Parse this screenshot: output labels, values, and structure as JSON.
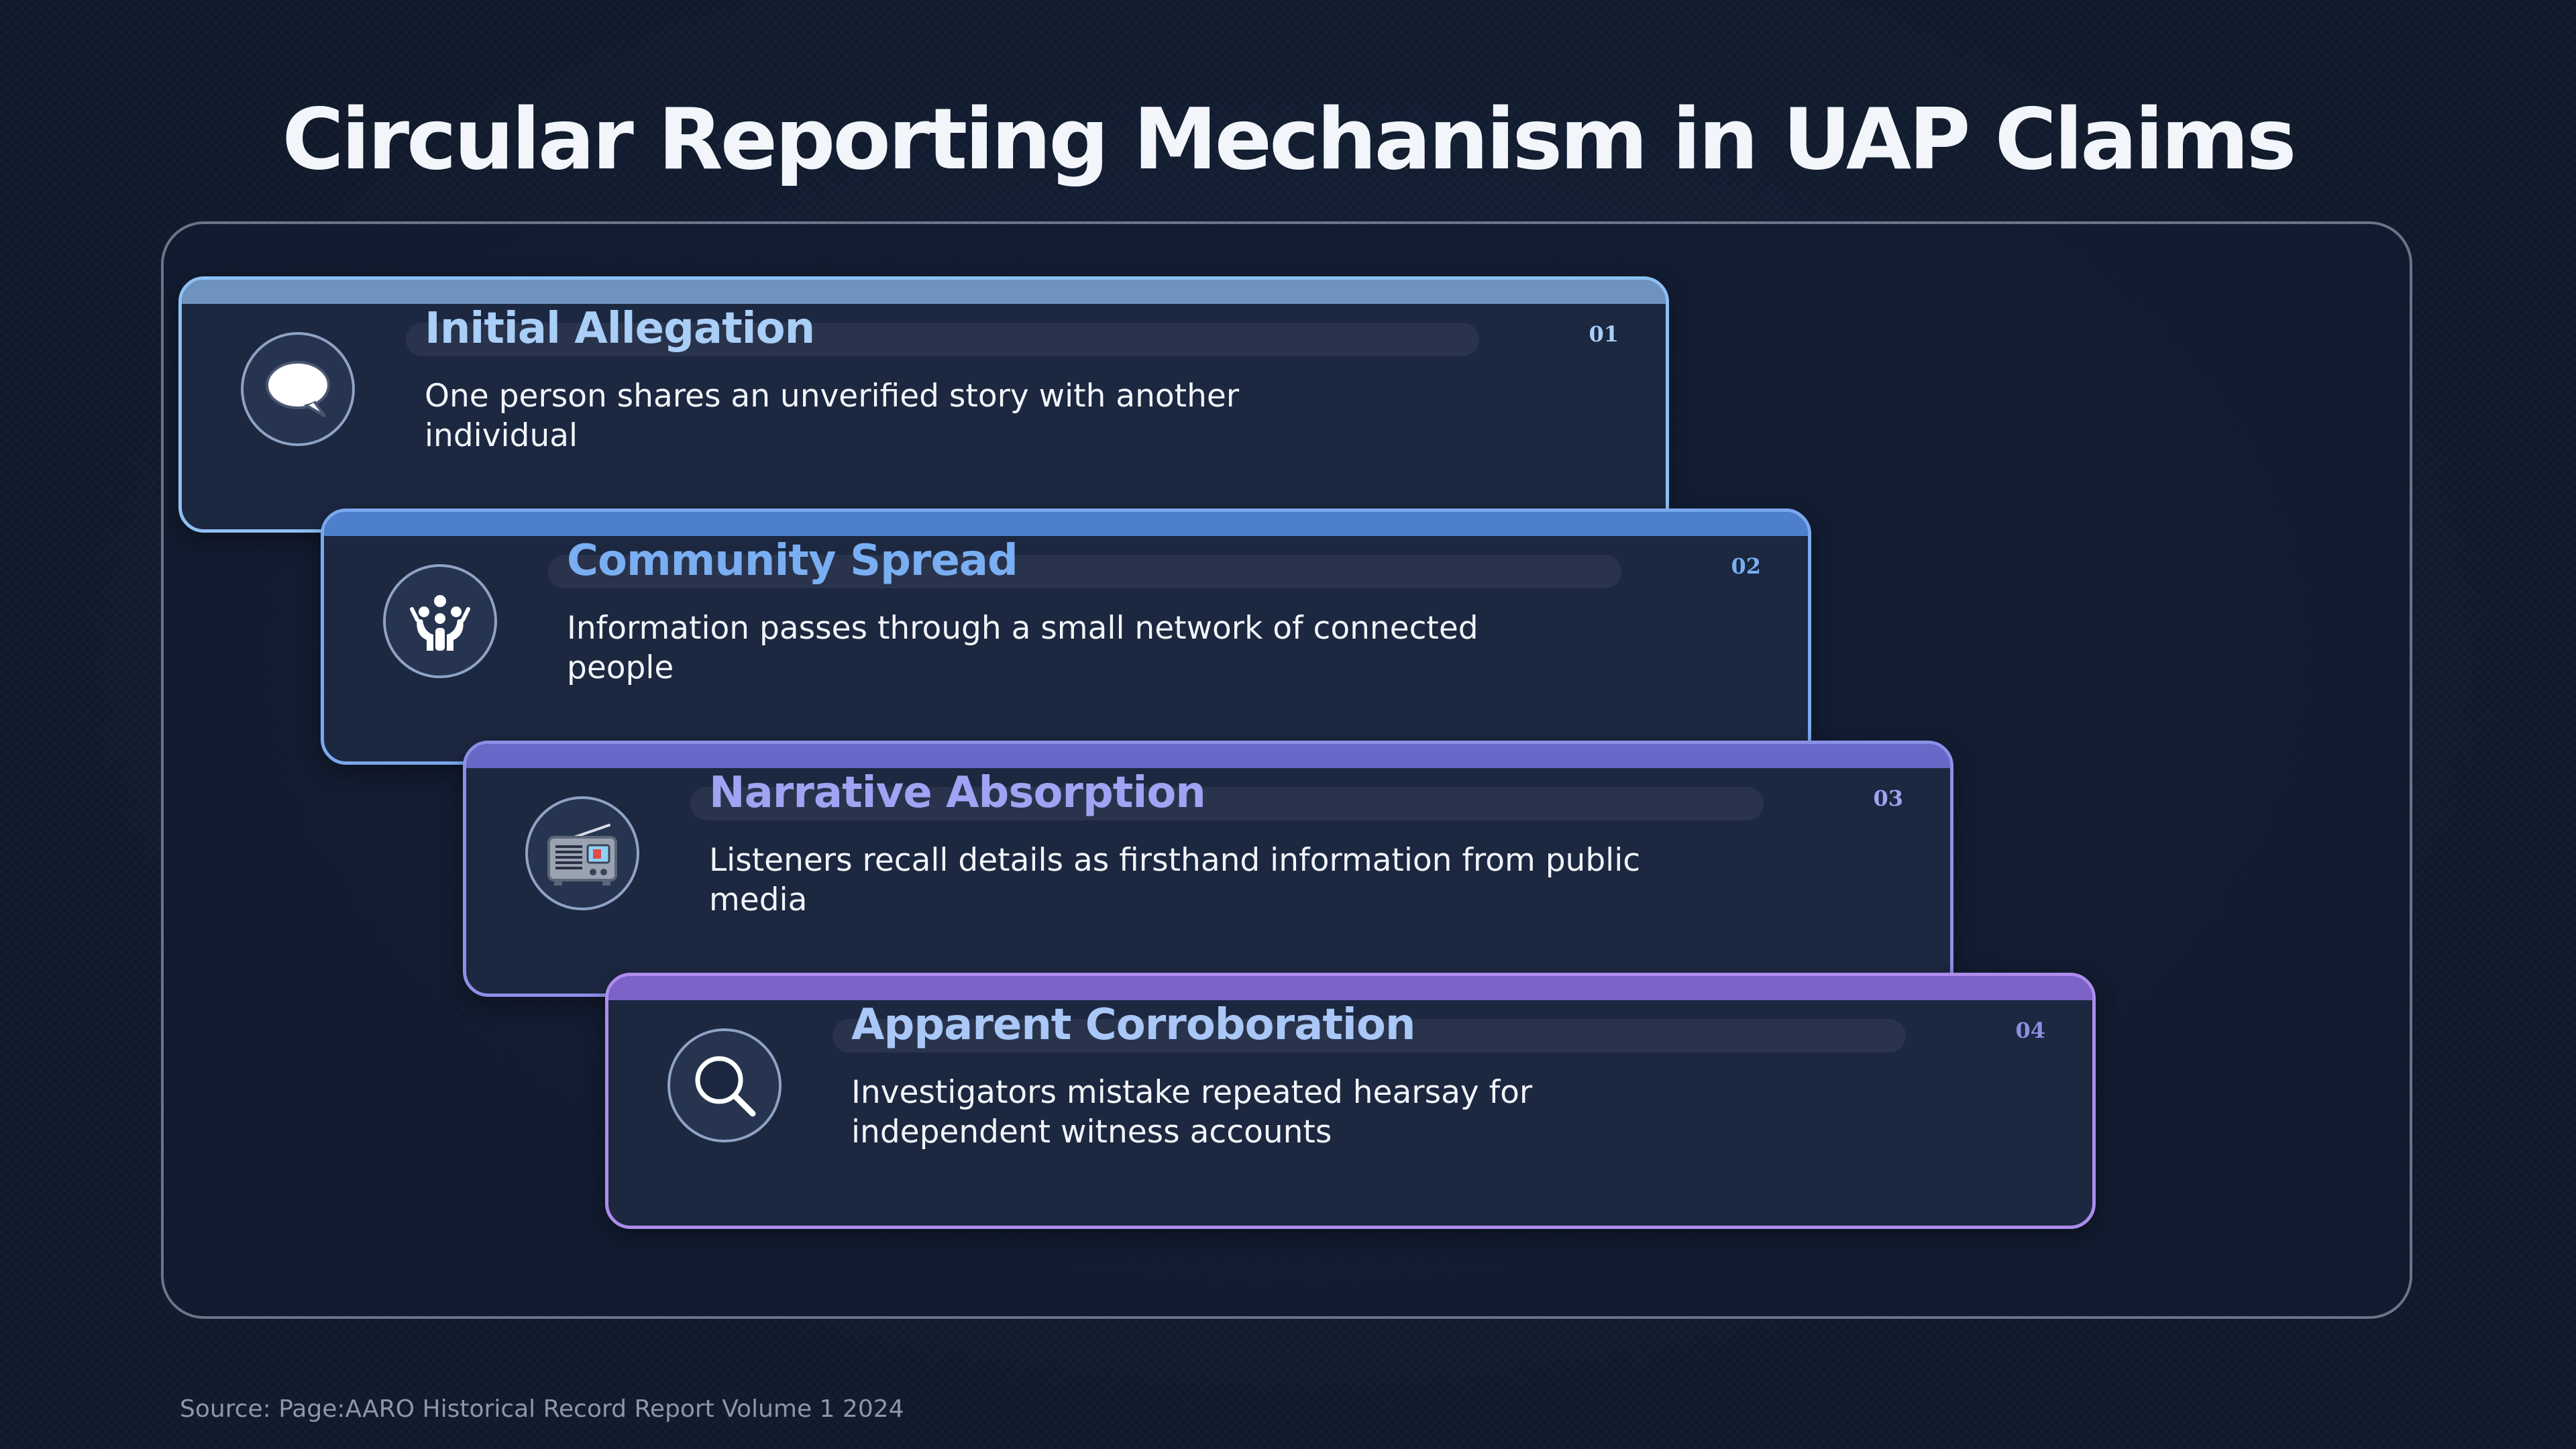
{
  "title": "Circular Reporting Mechanism in UAP Claims",
  "steps": [
    {
      "number": "01",
      "title": "Initial Allegation",
      "description": "One person shares an unverified story with another individual",
      "icon": "speech-bubble-icon"
    },
    {
      "number": "02",
      "title": "Community Spread",
      "description": "Information passes through a small network of connected people",
      "icon": "people-network-icon"
    },
    {
      "number": "03",
      "title": "Narrative Absorption",
      "description": "Listeners recall details as firsthand information from public media",
      "icon": "radio-icon"
    },
    {
      "number": "04",
      "title": "Apparent Corroboration",
      "description": "Investigators mistake repeated hearsay for independent witness accounts",
      "icon": "magnifying-glass-icon"
    }
  ],
  "source": "Source: Page:AARO Historical Record Report Volume 1 2024",
  "colors": {
    "background": "#101a2b",
    "card": "#1c2740",
    "step1_accent": "#8dc0f4",
    "step2_accent": "#7aa8ee",
    "step3_accent": "#8b90e6",
    "step4_accent": "#ad8cec"
  }
}
